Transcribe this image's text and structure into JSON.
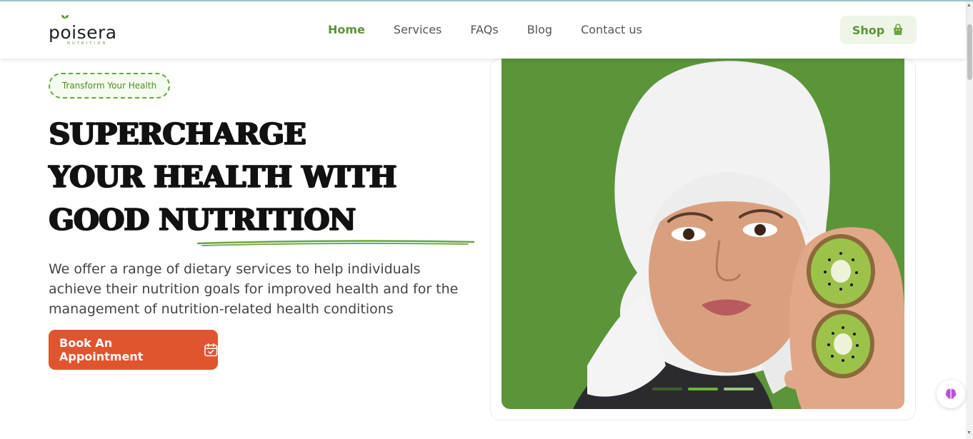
{
  "brand": {
    "name": "poisera",
    "tagline": "NUTRITION"
  },
  "nav": {
    "items": [
      {
        "label": "Home",
        "active": true
      },
      {
        "label": "Services",
        "active": false
      },
      {
        "label": "FAQs",
        "active": false
      },
      {
        "label": "Blog",
        "active": false
      },
      {
        "label": "Contact us",
        "active": false
      }
    ],
    "shop_label": "Shop",
    "shop_icon": "shopping-bag-icon"
  },
  "hero": {
    "badge": "Transform Your Health",
    "headline_lines": [
      "SUPERCHARGE",
      "YOUR HEALTH WITH",
      "GOOD NUTRITION"
    ],
    "description": "We offer a range of dietary services to help individuals achieve their nutrition goals for improved health and for the management of nutrition-related health conditions",
    "cta_label": "Book An Appointment",
    "cta_icon": "calendar-check-icon",
    "image_subject": "woman in white hijab holding kiwi halves",
    "slider": {
      "total": 3,
      "active_index": 1
    }
  },
  "colors": {
    "accent_green": "#5a9436",
    "image_bg": "#5c943a",
    "cta": "#e0552f"
  }
}
